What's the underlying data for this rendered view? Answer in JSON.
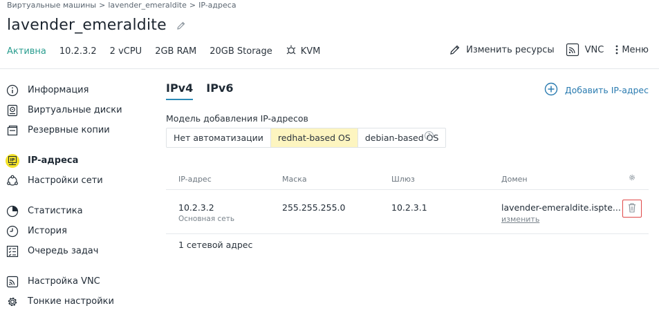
{
  "breadcrumb": {
    "items": [
      "Виртуальные машины",
      "lavender_emeraldite",
      "IP-адреса"
    ],
    "separator": ">"
  },
  "title": "lavender_emeraldite",
  "vm_info": {
    "status": "Активна",
    "ip": "10.2.3.2",
    "cpu": "2 vCPU",
    "ram": "2GB RAM",
    "storage": "20GB Storage",
    "virt": "KVM"
  },
  "actions": {
    "resize": "Изменить ресурсы",
    "vnc": "VNC",
    "menu": "Меню"
  },
  "sidebar": {
    "items": [
      {
        "label": "Информация",
        "icon": "info-icon"
      },
      {
        "label": "Виртуальные диски",
        "icon": "disk-icon"
      },
      {
        "label": "Резервные копии",
        "icon": "backup-icon"
      },
      {
        "label": "IP-адреса",
        "icon": "ip-icon"
      },
      {
        "label": "Настройки сети",
        "icon": "network-icon"
      },
      {
        "label": "Статистика",
        "icon": "stats-icon"
      },
      {
        "label": "История",
        "icon": "history-icon"
      },
      {
        "label": "Очередь задач",
        "icon": "tasks-icon"
      },
      {
        "label": "Настройка VNC",
        "icon": "vnc-icon"
      },
      {
        "label": "Тонкие настройки",
        "icon": "gear-icon"
      }
    ],
    "active_index": 3
  },
  "tabs": [
    "IPv4",
    "IPv6"
  ],
  "add_ip_label": "Добавить IP-адрес",
  "model": {
    "label": "Модель добавления IP-адресов",
    "options": [
      "Нет автоматизации",
      "redhat-based OS",
      "debian-based OS"
    ],
    "selected": "redhat-based OS",
    "help": "?"
  },
  "table": {
    "headers": [
      "IP-адрес",
      "Маска",
      "Шлюз",
      "Домен"
    ],
    "rows": [
      {
        "ip": "10.2.3.2",
        "ip_sub": "Основная сеть",
        "mask": "255.255.255.0",
        "gateway": "10.2.3.1",
        "domain": "lavender-emeraldite.ispte...",
        "domain_link": "изменить"
      }
    ],
    "count": "1 сетевой адрес"
  },
  "colors": {
    "accent": "#2a8ab6",
    "status": "#2a9d8f",
    "selected_segment": "#fdf5c0",
    "active_icon": "#f2e12a",
    "delete": "#e04646"
  }
}
